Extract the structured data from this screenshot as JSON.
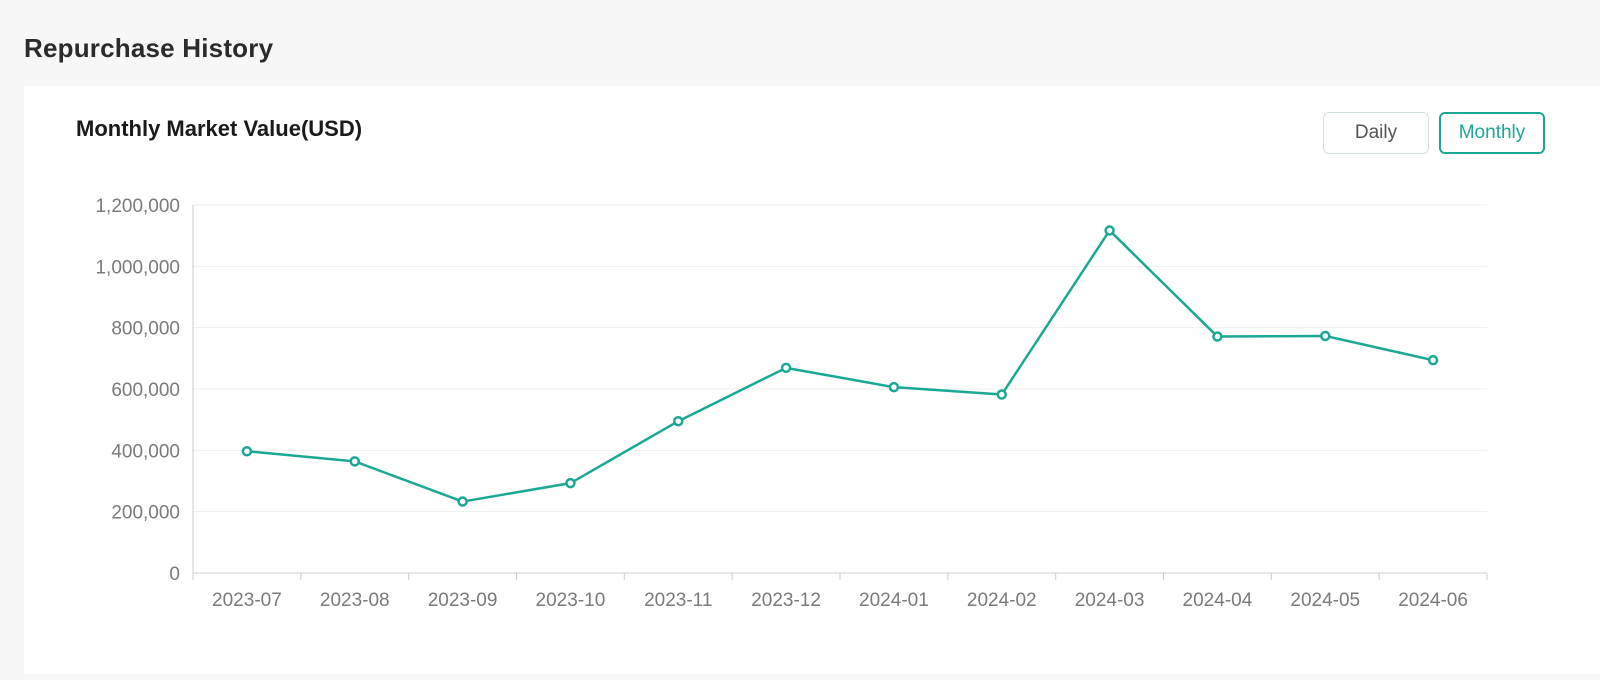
{
  "header": {
    "title": "Repurchase History"
  },
  "chart_header": {
    "title": "Monthly Market Value(USD)",
    "toggle": {
      "daily_label": "Daily",
      "monthly_label": "Monthly",
      "selected": "Monthly"
    }
  },
  "colors": {
    "accent": "#1aa894",
    "grid": "#efefef",
    "axis": "#cccccc"
  },
  "chart_data": {
    "type": "line",
    "categories": [
      "2023-07",
      "2023-08",
      "2023-09",
      "2023-10",
      "2023-11",
      "2023-12",
      "2024-01",
      "2024-02",
      "2024-03",
      "2024-04",
      "2024-05",
      "2024-06"
    ],
    "series": [
      {
        "values": [
          397000,
          364000,
          233000,
          293000,
          495000,
          669000,
          606000,
          582000,
          1117000,
          771000,
          773000,
          694000
        ]
      }
    ],
    "ylim": [
      0,
      1200000
    ],
    "yticks": [
      0,
      200000,
      400000,
      600000,
      800000,
      1000000,
      1200000
    ],
    "ytick_labels": [
      "0",
      "200,000",
      "400,000",
      "600,000",
      "800,000",
      "1,000,000",
      "1,200,000"
    ],
    "grid": true,
    "legend": "none"
  }
}
